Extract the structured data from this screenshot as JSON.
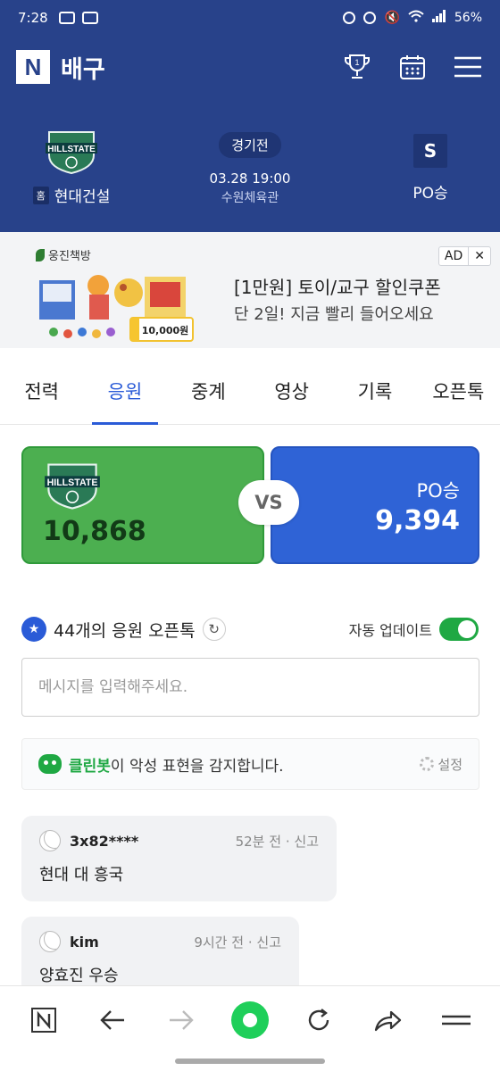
{
  "status_bar": {
    "time": "7:28",
    "battery": "56%"
  },
  "header": {
    "logo": "N",
    "title": "배구"
  },
  "match": {
    "home_team": "현대건설",
    "home_badge": "홈",
    "home_logo_text": "HILLSTATE",
    "status": "경기전",
    "datetime": "03.28 19:00",
    "venue": "수원체육관",
    "away_team": "PO승",
    "away_logo": "S"
  },
  "ad": {
    "brand": "웅진책방",
    "price_tag": "10,000원",
    "title": "[1만원] 토이/교구 할인쿠폰",
    "subtitle": "단 2일! 지금 빨리 들어오세요",
    "badge": "AD",
    "close": "✕"
  },
  "tabs": [
    {
      "label": "전력"
    },
    {
      "label": "응원"
    },
    {
      "label": "중계"
    },
    {
      "label": "영상"
    },
    {
      "label": "기록"
    },
    {
      "label": "오픈톡"
    }
  ],
  "active_tab": "응원",
  "cheer": {
    "home_logo_text": "HILLSTATE",
    "home_count": "10,868",
    "vs": "VS",
    "away_name": "PO승",
    "away_count": "9,394",
    "home_color": "#4caf50",
    "away_color": "#2f63d6"
  },
  "opentalk": {
    "title": "44개의 응원 오픈톡",
    "auto_update_label": "자동 업데이트",
    "auto_update_on": true
  },
  "message_input": {
    "placeholder": "메시지를 입력해주세요."
  },
  "cleanbot": {
    "name": "클린봇",
    "text": "이 악성 표현을 감지합니다.",
    "settings": "설정"
  },
  "comments": [
    {
      "user": "3x82****",
      "time": "52분 전",
      "report": "신고",
      "body": "현대 대 흥국"
    },
    {
      "user": "kim",
      "time": "9시간 전",
      "report": "신고",
      "body": "양효진 우승"
    }
  ],
  "colors": {
    "brand": "#28428a",
    "accent": "#2a5bd7",
    "green": "#1fa843"
  }
}
